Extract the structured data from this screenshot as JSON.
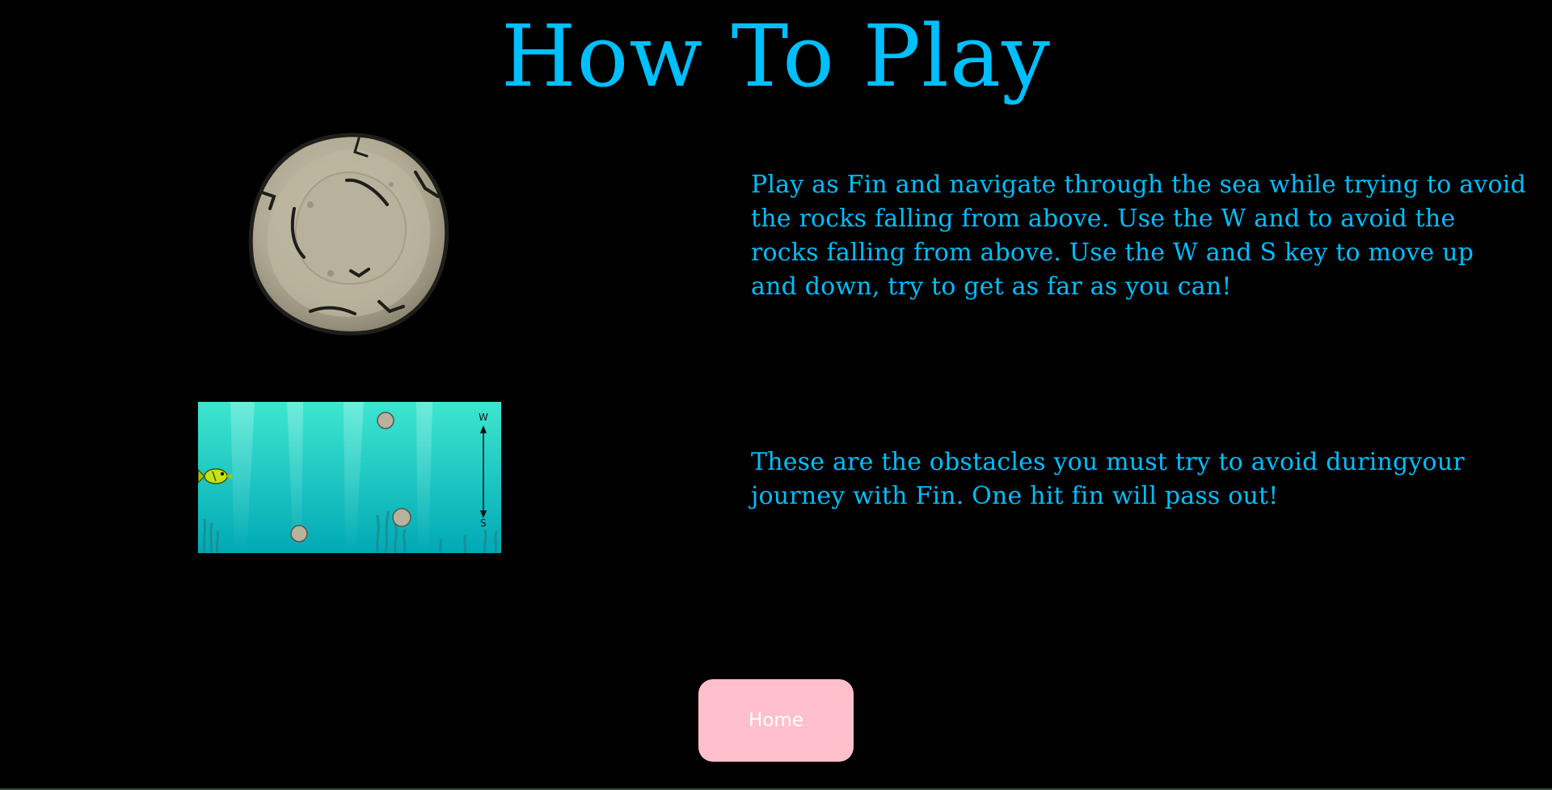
{
  "page": {
    "title": "How To Play",
    "paragraphs": [
      "Play as Fin and navigate through the sea while trying to avoid the rocks falling from above. Use the W and to avoid the rocks falling from above. Use the W and S key to move up and down, try to get as far as you can!",
      "These are the obstacles you must try to avoid duringyour journey with Fin. One hit fin will pass out!"
    ]
  },
  "preview": {
    "key_up": "W",
    "key_down": "S"
  },
  "buttons": {
    "home_label": "Home"
  },
  "colors": {
    "background": "#000000",
    "text_accent": "#00bfff",
    "button_bg": "#ffc0cb",
    "button_text": "#ffffff",
    "water_top": "#3ee6cf",
    "water_bottom": "#00a9b5"
  },
  "icons": [
    "rock-icon",
    "fish-icon",
    "arrow-up-down-icon"
  ]
}
